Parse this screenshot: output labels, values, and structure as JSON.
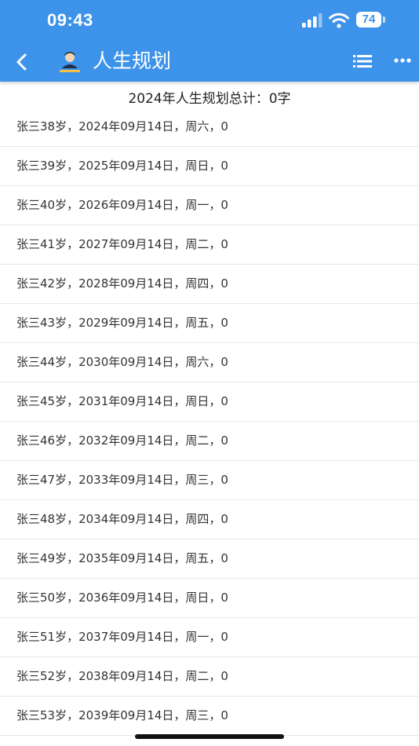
{
  "status_bar": {
    "time": "09:43",
    "battery_level": "74",
    "signal_icon": "cellular-signal-icon",
    "wifi_icon": "wifi-icon"
  },
  "header": {
    "title": "人生规划",
    "back_icon": "chevron-left-icon",
    "list_icon": "list-icon",
    "more_icon": "more-horizontal-icon",
    "background_color": "#3d93ea"
  },
  "summary": {
    "text": "2024年人生规划总计：0字"
  },
  "plans": [
    {
      "text": "张三38岁，2024年09月14日，周六，0"
    },
    {
      "text": "张三39岁，2025年09月14日，周日，0"
    },
    {
      "text": "张三40岁，2026年09月14日，周一，0"
    },
    {
      "text": "张三41岁，2027年09月14日，周二，0"
    },
    {
      "text": "张三42岁，2028年09月14日，周四，0"
    },
    {
      "text": "张三43岁，2029年09月14日，周五，0"
    },
    {
      "text": "张三44岁，2030年09月14日，周六，0"
    },
    {
      "text": "张三45岁，2031年09月14日，周日，0"
    },
    {
      "text": "张三46岁，2032年09月14日，周二，0"
    },
    {
      "text": "张三47岁，2033年09月14日，周三，0"
    },
    {
      "text": "张三48岁，2034年09月14日，周四，0"
    },
    {
      "text": "张三49岁，2035年09月14日，周五，0"
    },
    {
      "text": "张三50岁，2036年09月14日，周日，0"
    },
    {
      "text": "张三51岁，2037年09月14日，周一，0"
    },
    {
      "text": "张三52岁，2038年09月14日，周二，0"
    },
    {
      "text": "张三53岁，2039年09月14日，周三，0"
    }
  ]
}
